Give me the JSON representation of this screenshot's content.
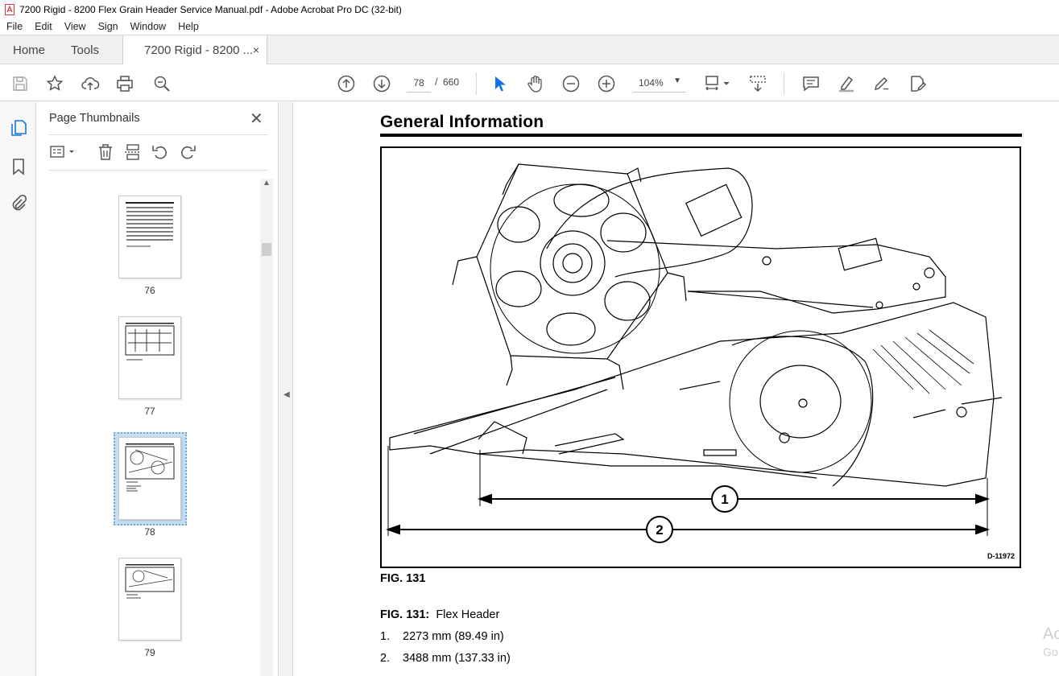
{
  "window": {
    "title": "7200 Rigid - 8200 Flex Grain Header Service Manual.pdf - Adobe Acrobat Pro DC (32-bit)"
  },
  "menu": [
    "File",
    "Edit",
    "View",
    "Sign",
    "Window",
    "Help"
  ],
  "tabs": {
    "home": "Home",
    "tools": "Tools",
    "document": "7200 Rigid - 8200 ...",
    "close": "×"
  },
  "toolbar": {
    "current_page": "78",
    "page_separator": "/",
    "total_pages": "660",
    "zoom": "104%"
  },
  "thumbnails": {
    "title": "Page Thumbnails",
    "close": "✕",
    "pages": [
      {
        "label": "76"
      },
      {
        "label": "77"
      },
      {
        "label": "78",
        "selected": true
      },
      {
        "label": "79"
      }
    ]
  },
  "document": {
    "heading": "General Information",
    "figure_code": "D-11972",
    "dimension_callouts": [
      "1",
      "2"
    ],
    "figure_label": "FIG. 131",
    "caption_prefix": "FIG. 131:",
    "caption_text": "Flex Header",
    "specs": [
      {
        "num": "1.",
        "text": "2273 mm (89.49 in)"
      },
      {
        "num": "2.",
        "text": "3488 mm (137.33 in)"
      }
    ]
  },
  "watermark": {
    "line1": "Ac",
    "line2": "Go"
  },
  "colors": {
    "accent_blue": "#1473e6",
    "select_blue": "#c9def1",
    "acrobat_red": "#d7373f"
  }
}
